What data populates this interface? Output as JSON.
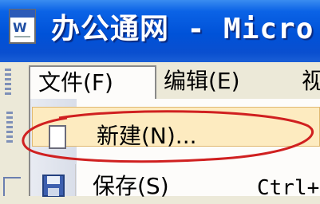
{
  "window": {
    "title": "办公通网 - Micro",
    "app_icon": "word-document-icon"
  },
  "menubar": {
    "items": [
      {
        "label": "文件(F)",
        "state": "open"
      },
      {
        "label": "编辑(E)"
      },
      {
        "label": "视"
      }
    ]
  },
  "file_menu": {
    "items": [
      {
        "label": "新建(N)...",
        "icon": "new-document-icon",
        "state": "highlighted",
        "annotation": "red-ellipse"
      },
      {
        "label": "保存(S)",
        "shortcut": "Ctrl+",
        "icon": "save-disk-icon"
      }
    ]
  },
  "colors": {
    "titlebar": "#0052d8",
    "menu_bg": "#ece9d8",
    "highlight": "#fdebc0",
    "annotation": "#d02020"
  }
}
